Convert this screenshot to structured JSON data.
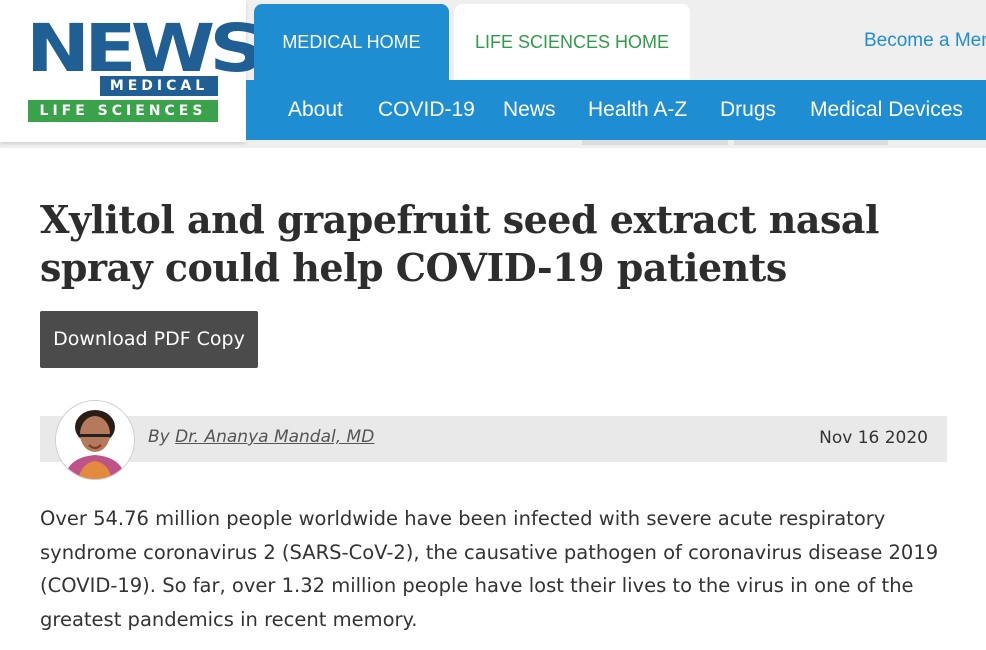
{
  "logo": {
    "news": "NEWS",
    "medical": "MEDICAL",
    "life_sciences": "LIFE SCIENCES"
  },
  "tabs": [
    {
      "label": "MEDICAL HOME"
    },
    {
      "label": "LIFE SCIENCES HOME"
    }
  ],
  "become_member": "Become a Mem",
  "nav": [
    {
      "label": "About"
    },
    {
      "label": "COVID-19"
    },
    {
      "label": "News"
    },
    {
      "label": "Health A-Z"
    },
    {
      "label": "Drugs"
    },
    {
      "label": "Medical Devices"
    }
  ],
  "article": {
    "title": "Xylitol and grapefruit seed extract nasal spray could help COVID-19 patients",
    "download_label": "Download PDF Copy",
    "by_prefix": "By ",
    "author": "Dr. Ananya Mandal, MD",
    "date": "Nov 16 2020",
    "body": "Over 54.76 million people worldwide have been infected with severe acute respiratory syndrome coronavirus 2 (SARS-CoV-2), the causative pathogen of coronavirus disease 2019 (COVID-19). So far, over 1.32 million people have lost their lives to the virus in one of the greatest pandemics in recent memory."
  },
  "colors": {
    "brand_blue": "#1f8dd2",
    "logo_blue": "#1f5f93",
    "brand_green": "#3aa24a",
    "life_green": "#2e9d49",
    "button_gray": "#4b4b4b"
  }
}
